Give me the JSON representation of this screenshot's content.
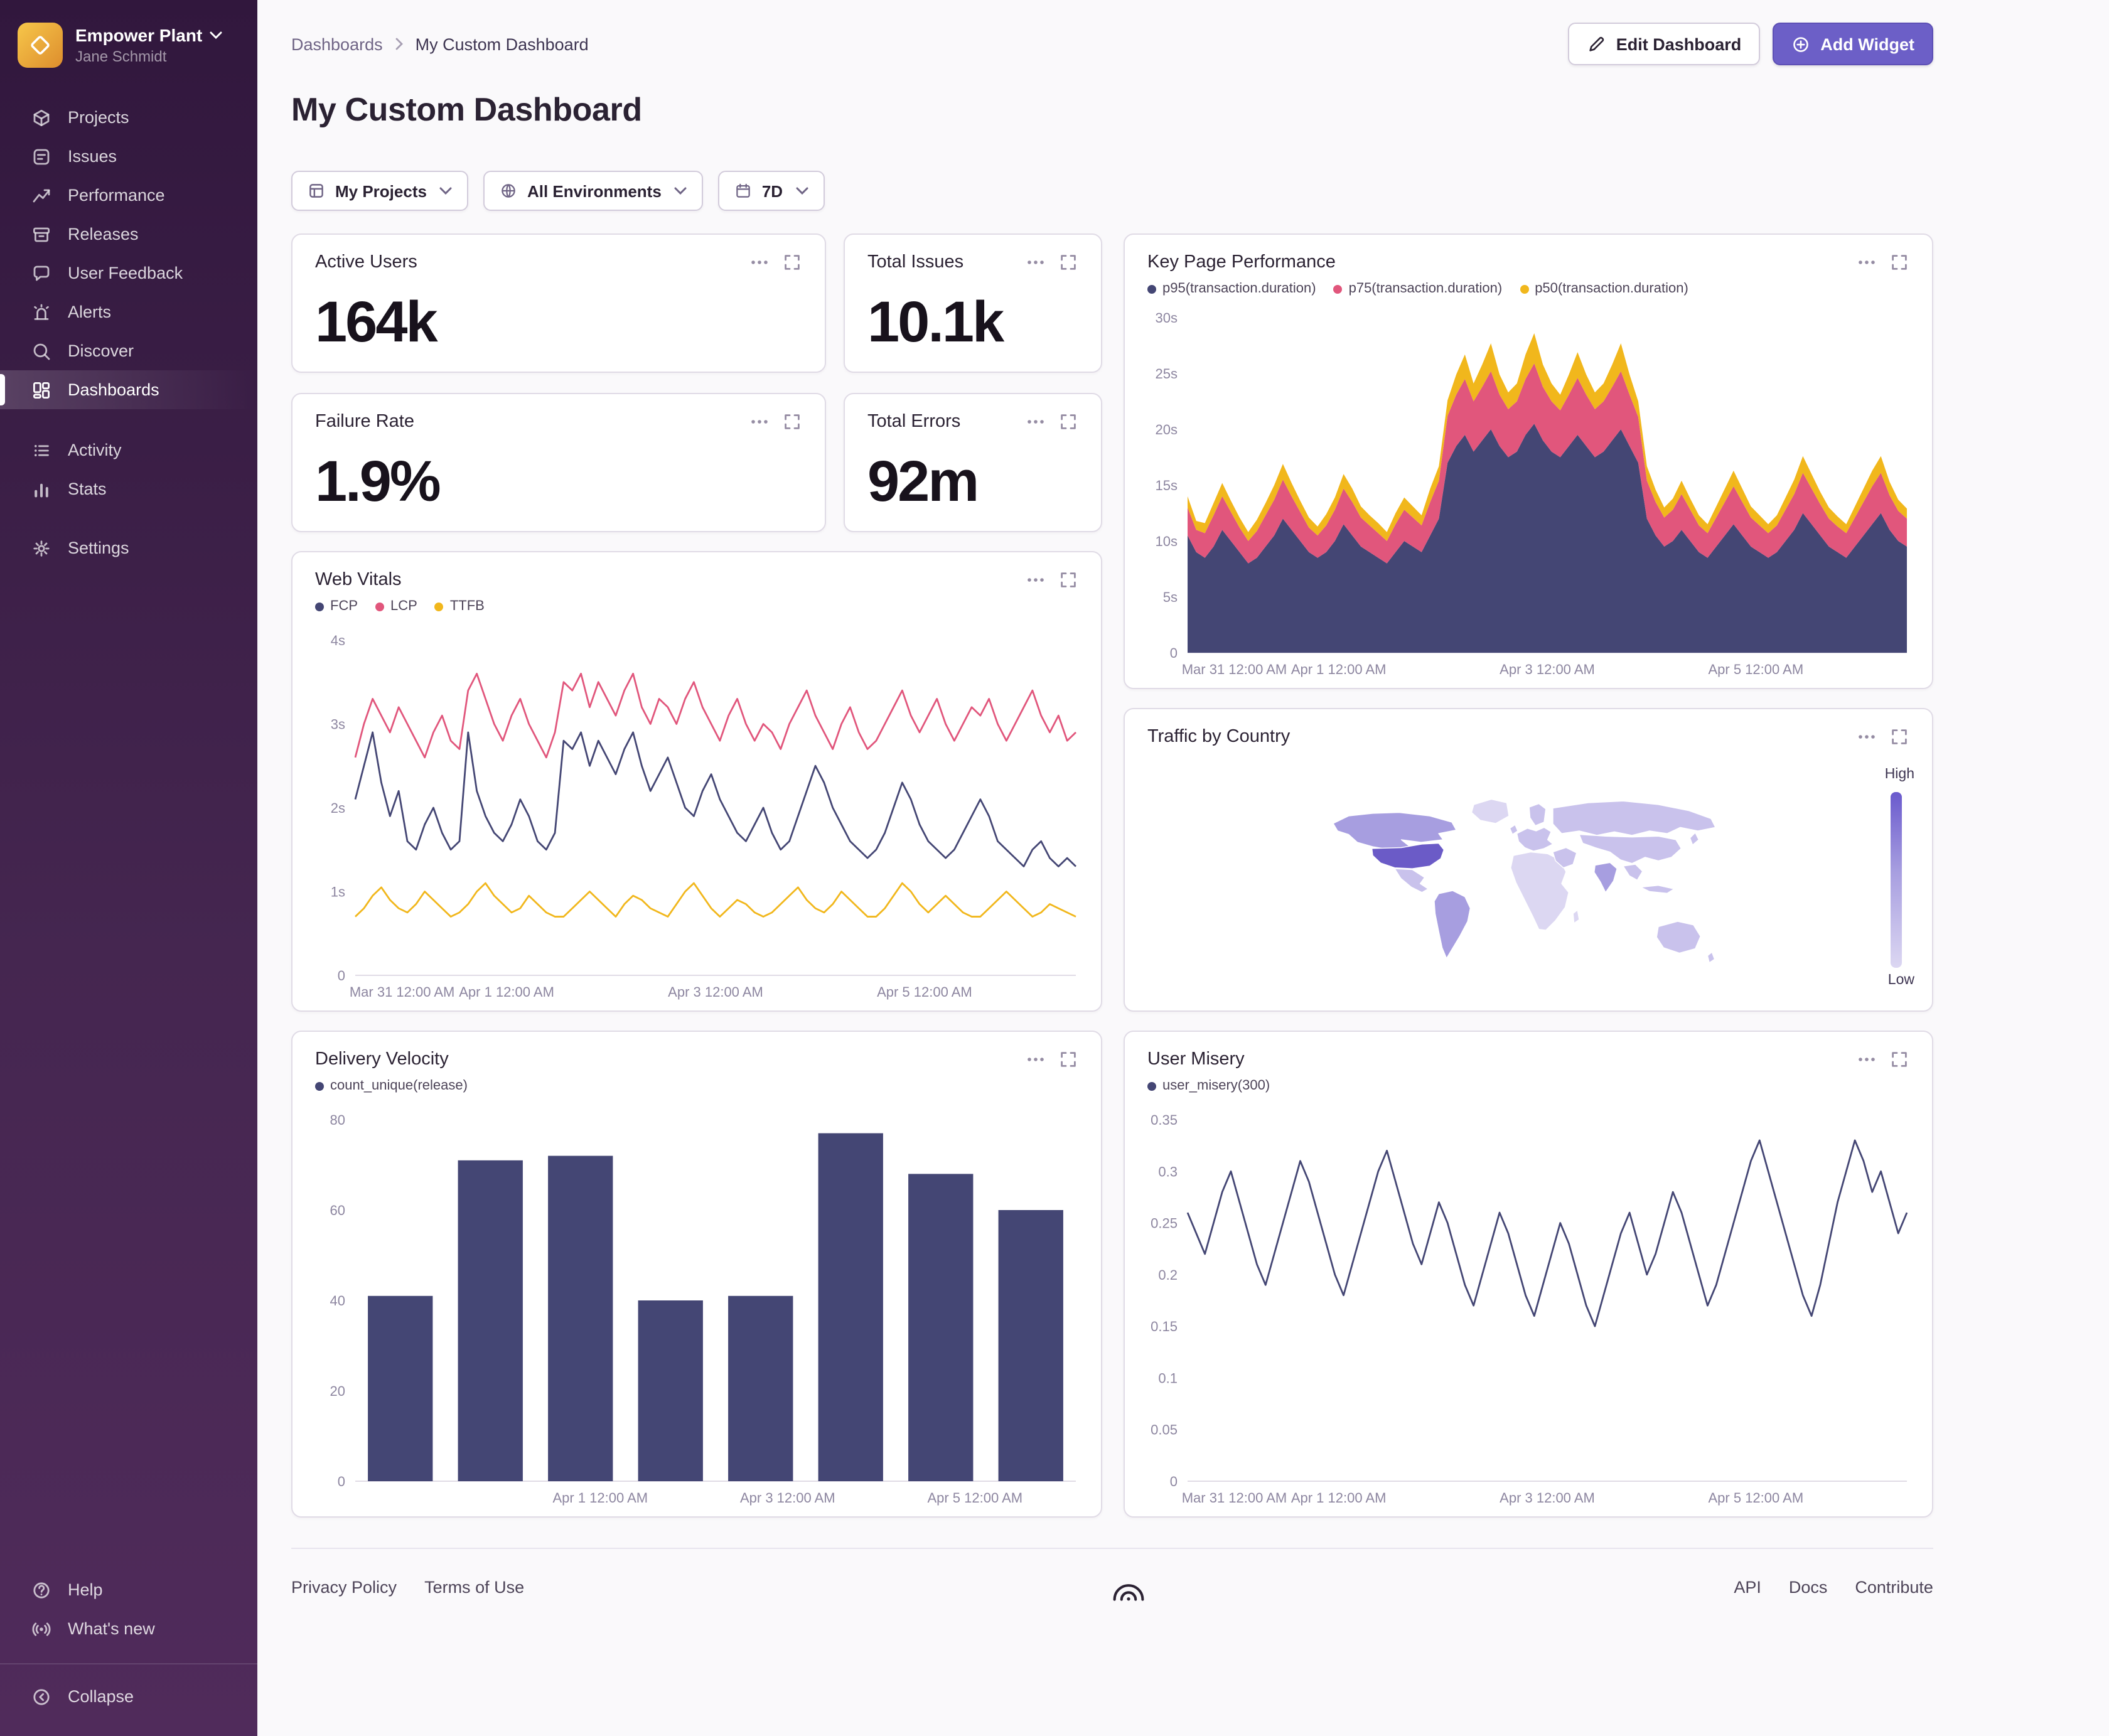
{
  "sidebar": {
    "org_name": "Empower Plant",
    "user_name": "Jane Schmidt",
    "primary": [
      {
        "id": "projects",
        "label": "Projects",
        "icon": "projects"
      },
      {
        "id": "issues",
        "label": "Issues",
        "icon": "issues"
      },
      {
        "id": "performance",
        "label": "Performance",
        "icon": "performance"
      },
      {
        "id": "releases",
        "label": "Releases",
        "icon": "releases"
      },
      {
        "id": "user-feedback",
        "label": "User Feedback",
        "icon": "user-feedback"
      },
      {
        "id": "alerts",
        "label": "Alerts",
        "icon": "alerts"
      },
      {
        "id": "discover",
        "label": "Discover",
        "icon": "discover"
      },
      {
        "id": "dashboards",
        "label": "Dashboards",
        "icon": "dashboards",
        "active": true
      }
    ],
    "secondary": [
      {
        "id": "activity",
        "label": "Activity",
        "icon": "activity"
      },
      {
        "id": "stats",
        "label": "Stats",
        "icon": "stats"
      }
    ],
    "settings": [
      {
        "id": "settings",
        "label": "Settings",
        "icon": "settings"
      }
    ],
    "footer": [
      {
        "id": "help",
        "label": "Help",
        "icon": "help"
      },
      {
        "id": "whats-new",
        "label": "What's new",
        "icon": "whats-new"
      }
    ],
    "collapse": [
      {
        "id": "collapse",
        "label": "Collapse",
        "icon": "collapse"
      }
    ]
  },
  "header": {
    "breadcrumb_root": "Dashboards",
    "breadcrumb_current": "My Custom Dashboard",
    "title": "My Custom Dashboard",
    "edit_button": "Edit Dashboard",
    "add_button": "Add Widget"
  },
  "filters": {
    "projects": "My Projects",
    "environments": "All Environments",
    "period": "7D"
  },
  "widgets": {
    "active_users": {
      "title": "Active Users",
      "value": "164k"
    },
    "total_issues": {
      "title": "Total Issues",
      "value": "10.1k"
    },
    "failure_rate": {
      "title": "Failure Rate",
      "value": "1.9%"
    },
    "total_errors": {
      "title": "Total Errors",
      "value": "92m"
    }
  },
  "chart_data": [
    {
      "id": "key-page-performance",
      "type": "area-stacked",
      "title": "Key Page Performance",
      "legend": [
        {
          "label": "p95(transaction.duration)",
          "color": "#444674"
        },
        {
          "label": "p75(transaction.duration)",
          "color": "#e1567c"
        },
        {
          "label": "p50(transaction.duration)",
          "color": "#f1b71c"
        }
      ],
      "ylim": [
        0,
        30
      ],
      "y_ticks": {
        "values": [
          0,
          5,
          10,
          15,
          20,
          25,
          30
        ],
        "labels": [
          "0",
          "5s",
          "10s",
          "15s",
          "20s",
          "25s",
          "30s"
        ]
      },
      "x_labels": [
        "Mar 31 12:00 AM",
        "Apr 1 12:00 AM",
        "Apr 3 12:00 AM",
        "Apr 5 12:00 AM"
      ],
      "x_label_fracs": [
        0.065,
        0.21,
        0.5,
        0.79
      ],
      "series": [
        {
          "name": "p95(transaction.duration)",
          "color": "#444674",
          "values": [
            10.5,
            9,
            8.5,
            9.5,
            11,
            10,
            9,
            8,
            8.5,
            9.5,
            10.5,
            12,
            11,
            10,
            9,
            8.5,
            9,
            10,
            11.5,
            10.5,
            9.5,
            9,
            8.5,
            8,
            9,
            10,
            9.5,
            9,
            10.5,
            12,
            17,
            18.5,
            19.5,
            18,
            19,
            20,
            18.5,
            17.5,
            18,
            19.5,
            20.5,
            19,
            18,
            17.5,
            18.5,
            19.5,
            18.5,
            17.5,
            18,
            19,
            20,
            18.5,
            17,
            12,
            10.5,
            9.5,
            10,
            11,
            10,
            9,
            8.5,
            9.5,
            10.5,
            11.5,
            10.5,
            9.5,
            9,
            8.5,
            9,
            10,
            11,
            12.5,
            11.5,
            10.5,
            9.5,
            9,
            8.5,
            9.5,
            10.5,
            11.5,
            12.5,
            11,
            10,
            9.5
          ]
        },
        {
          "name": "p75(transaction.duration)",
          "color": "#e1567c",
          "values": [
            2.5,
            2,
            2.2,
            2.8,
            3,
            2.6,
            2.2,
            2,
            2.4,
            2.8,
            3.2,
            3.5,
            3,
            2.6,
            2.2,
            2,
            2.4,
            2.8,
            3.2,
            3,
            2.6,
            2.4,
            2.2,
            2,
            2.5,
            2.8,
            2.6,
            2.4,
            3,
            3.4,
            4.2,
            4.6,
            5,
            4.5,
            4.8,
            5.2,
            4.6,
            4.3,
            4.5,
            5,
            5.4,
            4.8,
            4.5,
            4.2,
            4.6,
            5.1,
            4.6,
            4.3,
            4.5,
            4.8,
            5.2,
            4.6,
            4.1,
            3.4,
            3,
            2.6,
            2.8,
            3.2,
            2.8,
            2.4,
            2.2,
            2.6,
            3,
            3.4,
            3,
            2.6,
            2.4,
            2.2,
            2.4,
            2.8,
            3.2,
            3.6,
            3.2,
            2.8,
            2.5,
            2.3,
            2.2,
            2.6,
            3,
            3.4,
            3.6,
            3.1,
            2.7,
            2.5
          ]
        },
        {
          "name": "p50(transaction.duration)",
          "color": "#f1b71c",
          "values": [
            1,
            0.8,
            0.9,
            1.1,
            1.2,
            1,
            0.9,
            0.8,
            1,
            1.1,
            1.3,
            1.4,
            1.2,
            1,
            0.9,
            0.8,
            1,
            1.1,
            1.3,
            1.2,
            1,
            0.9,
            0.9,
            0.8,
            1,
            1.1,
            1,
            0.9,
            1.2,
            1.3,
            1.4,
            1.8,
            2.2,
            1.6,
            2,
            2.5,
            1.8,
            1.5,
            1.6,
            2.2,
            2.7,
            2,
            1.6,
            1.4,
            1.8,
            2.3,
            1.8,
            1.5,
            1.6,
            2,
            2.5,
            1.8,
            1.4,
            1.3,
            1.1,
            0.9,
            1,
            1.2,
            1,
            0.9,
            0.8,
            1,
            1.2,
            1.4,
            1.2,
            1,
            0.9,
            0.8,
            0.9,
            1.1,
            1.3,
            1.5,
            1.3,
            1.1,
            1,
            0.9,
            0.8,
            1,
            1.2,
            1.4,
            1.5,
            1.2,
            1,
            0.9
          ]
        }
      ]
    },
    {
      "id": "web-vitals",
      "type": "line",
      "title": "Web Vitals",
      "legend": [
        {
          "label": "FCP",
          "color": "#444674"
        },
        {
          "label": "LCP",
          "color": "#e1567c"
        },
        {
          "label": "TTFB",
          "color": "#f1b71c"
        }
      ],
      "ylim": [
        0,
        4
      ],
      "y_ticks": {
        "values": [
          0,
          1,
          2,
          3,
          4
        ],
        "labels": [
          "0",
          "1s",
          "2s",
          "3s",
          "4s"
        ]
      },
      "x_labels": [
        "Mar 31 12:00 AM",
        "Apr 1 12:00 AM",
        "Apr 3 12:00 AM",
        "Apr 5 12:00 AM"
      ],
      "x_label_fracs": [
        0.065,
        0.21,
        0.5,
        0.79
      ],
      "series": [
        {
          "name": "FCP",
          "color": "#444674",
          "values": [
            2.1,
            2.5,
            2.9,
            2.3,
            1.9,
            2.2,
            1.6,
            1.5,
            1.8,
            2.0,
            1.7,
            1.5,
            1.6,
            2.9,
            2.2,
            1.9,
            1.7,
            1.6,
            1.8,
            2.1,
            1.9,
            1.6,
            1.5,
            1.7,
            2.8,
            2.7,
            2.9,
            2.5,
            2.8,
            2.6,
            2.4,
            2.7,
            2.9,
            2.5,
            2.2,
            2.4,
            2.6,
            2.3,
            2.0,
            1.9,
            2.2,
            2.4,
            2.1,
            1.9,
            1.7,
            1.6,
            1.8,
            2.0,
            1.7,
            1.5,
            1.6,
            1.9,
            2.2,
            2.5,
            2.3,
            2.0,
            1.8,
            1.6,
            1.5,
            1.4,
            1.5,
            1.7,
            2.0,
            2.3,
            2.1,
            1.8,
            1.6,
            1.5,
            1.4,
            1.5,
            1.7,
            1.9,
            2.1,
            1.9,
            1.6,
            1.5,
            1.4,
            1.3,
            1.5,
            1.6,
            1.4,
            1.3,
            1.4,
            1.3
          ]
        },
        {
          "name": "LCP",
          "color": "#e1567c",
          "values": [
            2.6,
            3.0,
            3.3,
            3.1,
            2.9,
            3.2,
            3.0,
            2.8,
            2.6,
            2.9,
            3.1,
            2.8,
            2.7,
            3.4,
            3.6,
            3.3,
            3.0,
            2.8,
            3.1,
            3.3,
            3.0,
            2.8,
            2.6,
            2.9,
            3.5,
            3.4,
            3.6,
            3.2,
            3.5,
            3.3,
            3.1,
            3.4,
            3.6,
            3.2,
            3.0,
            3.3,
            3.2,
            3.0,
            3.3,
            3.5,
            3.2,
            3.0,
            2.8,
            3.1,
            3.3,
            3.0,
            2.8,
            3.0,
            2.9,
            2.7,
            3.0,
            3.2,
            3.4,
            3.1,
            2.9,
            2.7,
            3.0,
            3.2,
            2.9,
            2.7,
            2.8,
            3.0,
            3.2,
            3.4,
            3.1,
            2.9,
            3.1,
            3.3,
            3.0,
            2.8,
            3.0,
            3.2,
            3.1,
            3.3,
            3.0,
            2.8,
            3.0,
            3.2,
            3.4,
            3.1,
            2.9,
            3.1,
            2.8,
            2.9
          ]
        },
        {
          "name": "TTFB",
          "color": "#f1b71c",
          "values": [
            0.7,
            0.8,
            0.95,
            1.05,
            0.9,
            0.8,
            0.75,
            0.85,
            1.0,
            0.9,
            0.8,
            0.7,
            0.75,
            0.85,
            1.0,
            1.1,
            0.95,
            0.85,
            0.75,
            0.8,
            0.95,
            0.85,
            0.75,
            0.7,
            0.7,
            0.8,
            0.9,
            1.0,
            0.9,
            0.8,
            0.7,
            0.85,
            0.95,
            0.9,
            0.8,
            0.75,
            0.7,
            0.85,
            1.0,
            1.1,
            0.95,
            0.8,
            0.7,
            0.8,
            0.9,
            0.85,
            0.75,
            0.7,
            0.75,
            0.85,
            0.95,
            1.05,
            0.9,
            0.8,
            0.75,
            0.85,
            1.0,
            0.9,
            0.8,
            0.7,
            0.7,
            0.8,
            0.95,
            1.1,
            1.0,
            0.85,
            0.75,
            0.85,
            0.95,
            0.85,
            0.75,
            0.7,
            0.7,
            0.8,
            0.9,
            1.0,
            0.9,
            0.8,
            0.7,
            0.75,
            0.85,
            0.8,
            0.75,
            0.7
          ]
        }
      ]
    },
    {
      "id": "traffic-by-country",
      "type": "choropleth",
      "title": "Traffic by Country",
      "legend_high": "High",
      "legend_low": "Low",
      "level_colors": {
        "high": "#6b5bc7",
        "medium": "#a79ee0",
        "light": "#c9c2ec",
        "pale": "#dcd7f2"
      },
      "regions": {
        "usa": "high",
        "canada": "medium",
        "greenland": "pale",
        "mexico": "light",
        "south-america": "medium",
        "europe": "light",
        "scandinavia": "light",
        "uk": "light",
        "africa": "pale",
        "madagascar": "pale",
        "russia": "light",
        "middle-east": "light",
        "china": "light",
        "india": "medium",
        "se-asia": "light",
        "indonesia": "light",
        "japan": "light",
        "australia": "light",
        "new-zealand": "light"
      }
    },
    {
      "id": "delivery-velocity",
      "type": "bar",
      "title": "Delivery Velocity",
      "legend": [
        {
          "label": "count_unique(release)",
          "color": "#444674"
        }
      ],
      "color": "#444674",
      "categories": [
        "bar1",
        "bar2",
        "bar3",
        "bar4",
        "bar5",
        "bar6",
        "bar7",
        "bar8"
      ],
      "values": [
        41,
        71,
        72,
        40,
        41,
        77,
        68,
        60
      ],
      "ylim": [
        0,
        80
      ],
      "y_ticks": {
        "values": [
          0,
          20,
          40,
          60,
          80
        ],
        "labels": [
          "0",
          "20",
          "40",
          "60",
          "80"
        ]
      },
      "x_labels": [
        "Apr 1 12:00 AM",
        "Apr 3 12:00 AM",
        "Apr 5 12:00 AM"
      ],
      "x_label_fracs": [
        0.34,
        0.6,
        0.86
      ]
    },
    {
      "id": "user-misery",
      "type": "line",
      "title": "User Misery",
      "legend": [
        {
          "label": "user_misery(300)",
          "color": "#444674"
        }
      ],
      "ylim": [
        0,
        0.35
      ],
      "y_ticks": {
        "values": [
          0,
          0.05,
          0.1,
          0.15,
          0.2,
          0.25,
          0.3,
          0.35
        ],
        "labels": [
          "0",
          "0.05",
          "0.1",
          "0.15",
          "0.2",
          "0.25",
          "0.3",
          "0.35"
        ]
      },
      "x_labels": [
        "Mar 31 12:00 AM",
        "Apr 1 12:00 AM",
        "Apr 3 12:00 AM",
        "Apr 5 12:00 AM"
      ],
      "x_label_fracs": [
        0.065,
        0.21,
        0.5,
        0.79
      ],
      "series": [
        {
          "name": "user_misery(300)",
          "color": "#444674",
          "values": [
            0.26,
            0.24,
            0.22,
            0.25,
            0.28,
            0.3,
            0.27,
            0.24,
            0.21,
            0.19,
            0.22,
            0.25,
            0.28,
            0.31,
            0.29,
            0.26,
            0.23,
            0.2,
            0.18,
            0.21,
            0.24,
            0.27,
            0.3,
            0.32,
            0.29,
            0.26,
            0.23,
            0.21,
            0.24,
            0.27,
            0.25,
            0.22,
            0.19,
            0.17,
            0.2,
            0.23,
            0.26,
            0.24,
            0.21,
            0.18,
            0.16,
            0.19,
            0.22,
            0.25,
            0.23,
            0.2,
            0.17,
            0.15,
            0.18,
            0.21,
            0.24,
            0.26,
            0.23,
            0.2,
            0.22,
            0.25,
            0.28,
            0.26,
            0.23,
            0.2,
            0.17,
            0.19,
            0.22,
            0.25,
            0.28,
            0.31,
            0.33,
            0.3,
            0.27,
            0.24,
            0.21,
            0.18,
            0.16,
            0.19,
            0.23,
            0.27,
            0.3,
            0.33,
            0.31,
            0.28,
            0.3,
            0.27,
            0.24,
            0.26
          ]
        }
      ]
    }
  ],
  "page_footer": {
    "privacy": "Privacy Policy",
    "terms": "Terms of Use",
    "api": "API",
    "docs": "Docs",
    "contribute": "Contribute"
  },
  "colors": {
    "accent": "#6C5FC7",
    "chart_navy": "#444674",
    "chart_pink": "#e1567c",
    "chart_yellow": "#f1b71c",
    "sidebar_top": "#31173d",
    "sidebar_bottom": "#502b5b"
  }
}
